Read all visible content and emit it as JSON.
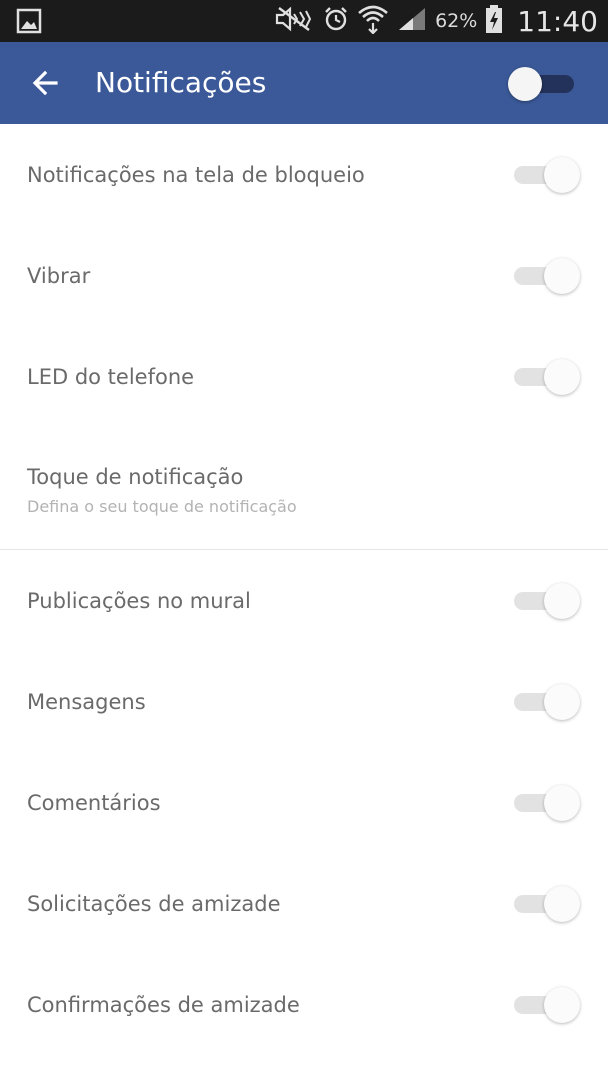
{
  "status_bar": {
    "icons": [
      "image-notification-icon",
      "mute-icon",
      "alarm-icon",
      "wifi-icon",
      "signal-icon"
    ],
    "battery_percent": "62%",
    "time": "11:40"
  },
  "app_bar": {
    "title": "Notificações",
    "master_toggle_on": false,
    "color": "#3b5998"
  },
  "settings": {
    "items": [
      {
        "label": "Notificações na tela de bloqueio",
        "enabled": true
      },
      {
        "label": "Vibrar",
        "enabled": true
      },
      {
        "label": "LED do telefone",
        "enabled": true
      }
    ],
    "tone": {
      "title": "Toque de notificação",
      "subtitle": "Defina o seu toque de notificação"
    },
    "items2": [
      {
        "label": "Publicações no mural",
        "enabled": true
      },
      {
        "label": "Mensagens",
        "enabled": true
      },
      {
        "label": "Comentários",
        "enabled": true
      },
      {
        "label": "Solicitações de amizade",
        "enabled": true
      },
      {
        "label": "Confirmações de amizade",
        "enabled": true
      }
    ]
  }
}
